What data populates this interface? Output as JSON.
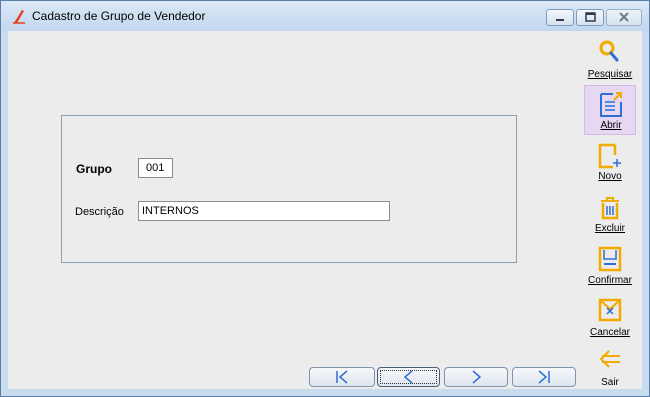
{
  "window": {
    "title": "Cadastro de Grupo de Vendedor",
    "controls": {
      "minimize": "minimize-icon",
      "maximize": "maximize-icon",
      "close": "close-icon"
    }
  },
  "form": {
    "grupo_label": "Grupo",
    "grupo_value": "001",
    "descricao_label": "Descrição",
    "descricao_value": "INTERNOS"
  },
  "toolbar": [
    {
      "id": "pesquisar",
      "label": "Pesquisar",
      "icon": "search-icon"
    },
    {
      "id": "abrir",
      "label": "Abrir",
      "icon": "open-document-icon",
      "state": "hover"
    },
    {
      "id": "novo",
      "label": "Novo",
      "icon": "new-document-icon"
    },
    {
      "id": "excluir",
      "label": "Excluir",
      "icon": "trash-icon"
    },
    {
      "id": "confirmar",
      "label": "Confirmar",
      "icon": "save-icon"
    },
    {
      "id": "cancelar",
      "label": "Cancelar",
      "icon": "cancel-icon"
    },
    {
      "id": "sair",
      "label": "Sair",
      "icon": "exit-arrow-icon"
    }
  ],
  "navigation": [
    {
      "id": "first",
      "icon": "first-record-icon"
    },
    {
      "id": "previous",
      "icon": "previous-record-icon",
      "state": "focused"
    },
    {
      "id": "next",
      "icon": "next-record-icon"
    },
    {
      "id": "last",
      "icon": "last-record-icon"
    }
  ],
  "colors": {
    "accent": "#f2a900",
    "icon_blue": "#2c6fd6",
    "hover": "#e6d7f3",
    "client_bg": "#ececec"
  }
}
